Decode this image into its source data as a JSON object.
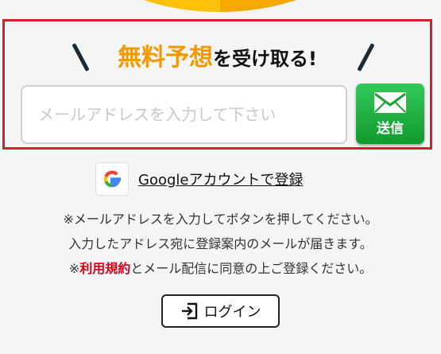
{
  "signup": {
    "headline_highlight": "無料予想",
    "headline_rest": "を受け取る!",
    "email_placeholder": "メールアドレスを入力して下さい",
    "email_value": "",
    "send_label": "送信"
  },
  "google": {
    "link_label": "Googleアカウントで登録"
  },
  "notes": {
    "line1": "※メールアドレスを入力してボタンを押してください。",
    "line2": "入力したアドレス宛に登録案内のメールが届きます。",
    "line3_prefix": "※",
    "terms_link": "利用規約",
    "line3_suffix": "とメール配信に同意の上ご登録ください。"
  },
  "login": {
    "label": "ログイン"
  },
  "colors": {
    "accent_orange": "#f39800",
    "frame_red": "#d3202c",
    "send_green": "#1fb043",
    "terms_red": "#e0001a"
  },
  "icons": {
    "send": "mail-icon",
    "google": "google-g-icon",
    "login": "login-icon"
  }
}
